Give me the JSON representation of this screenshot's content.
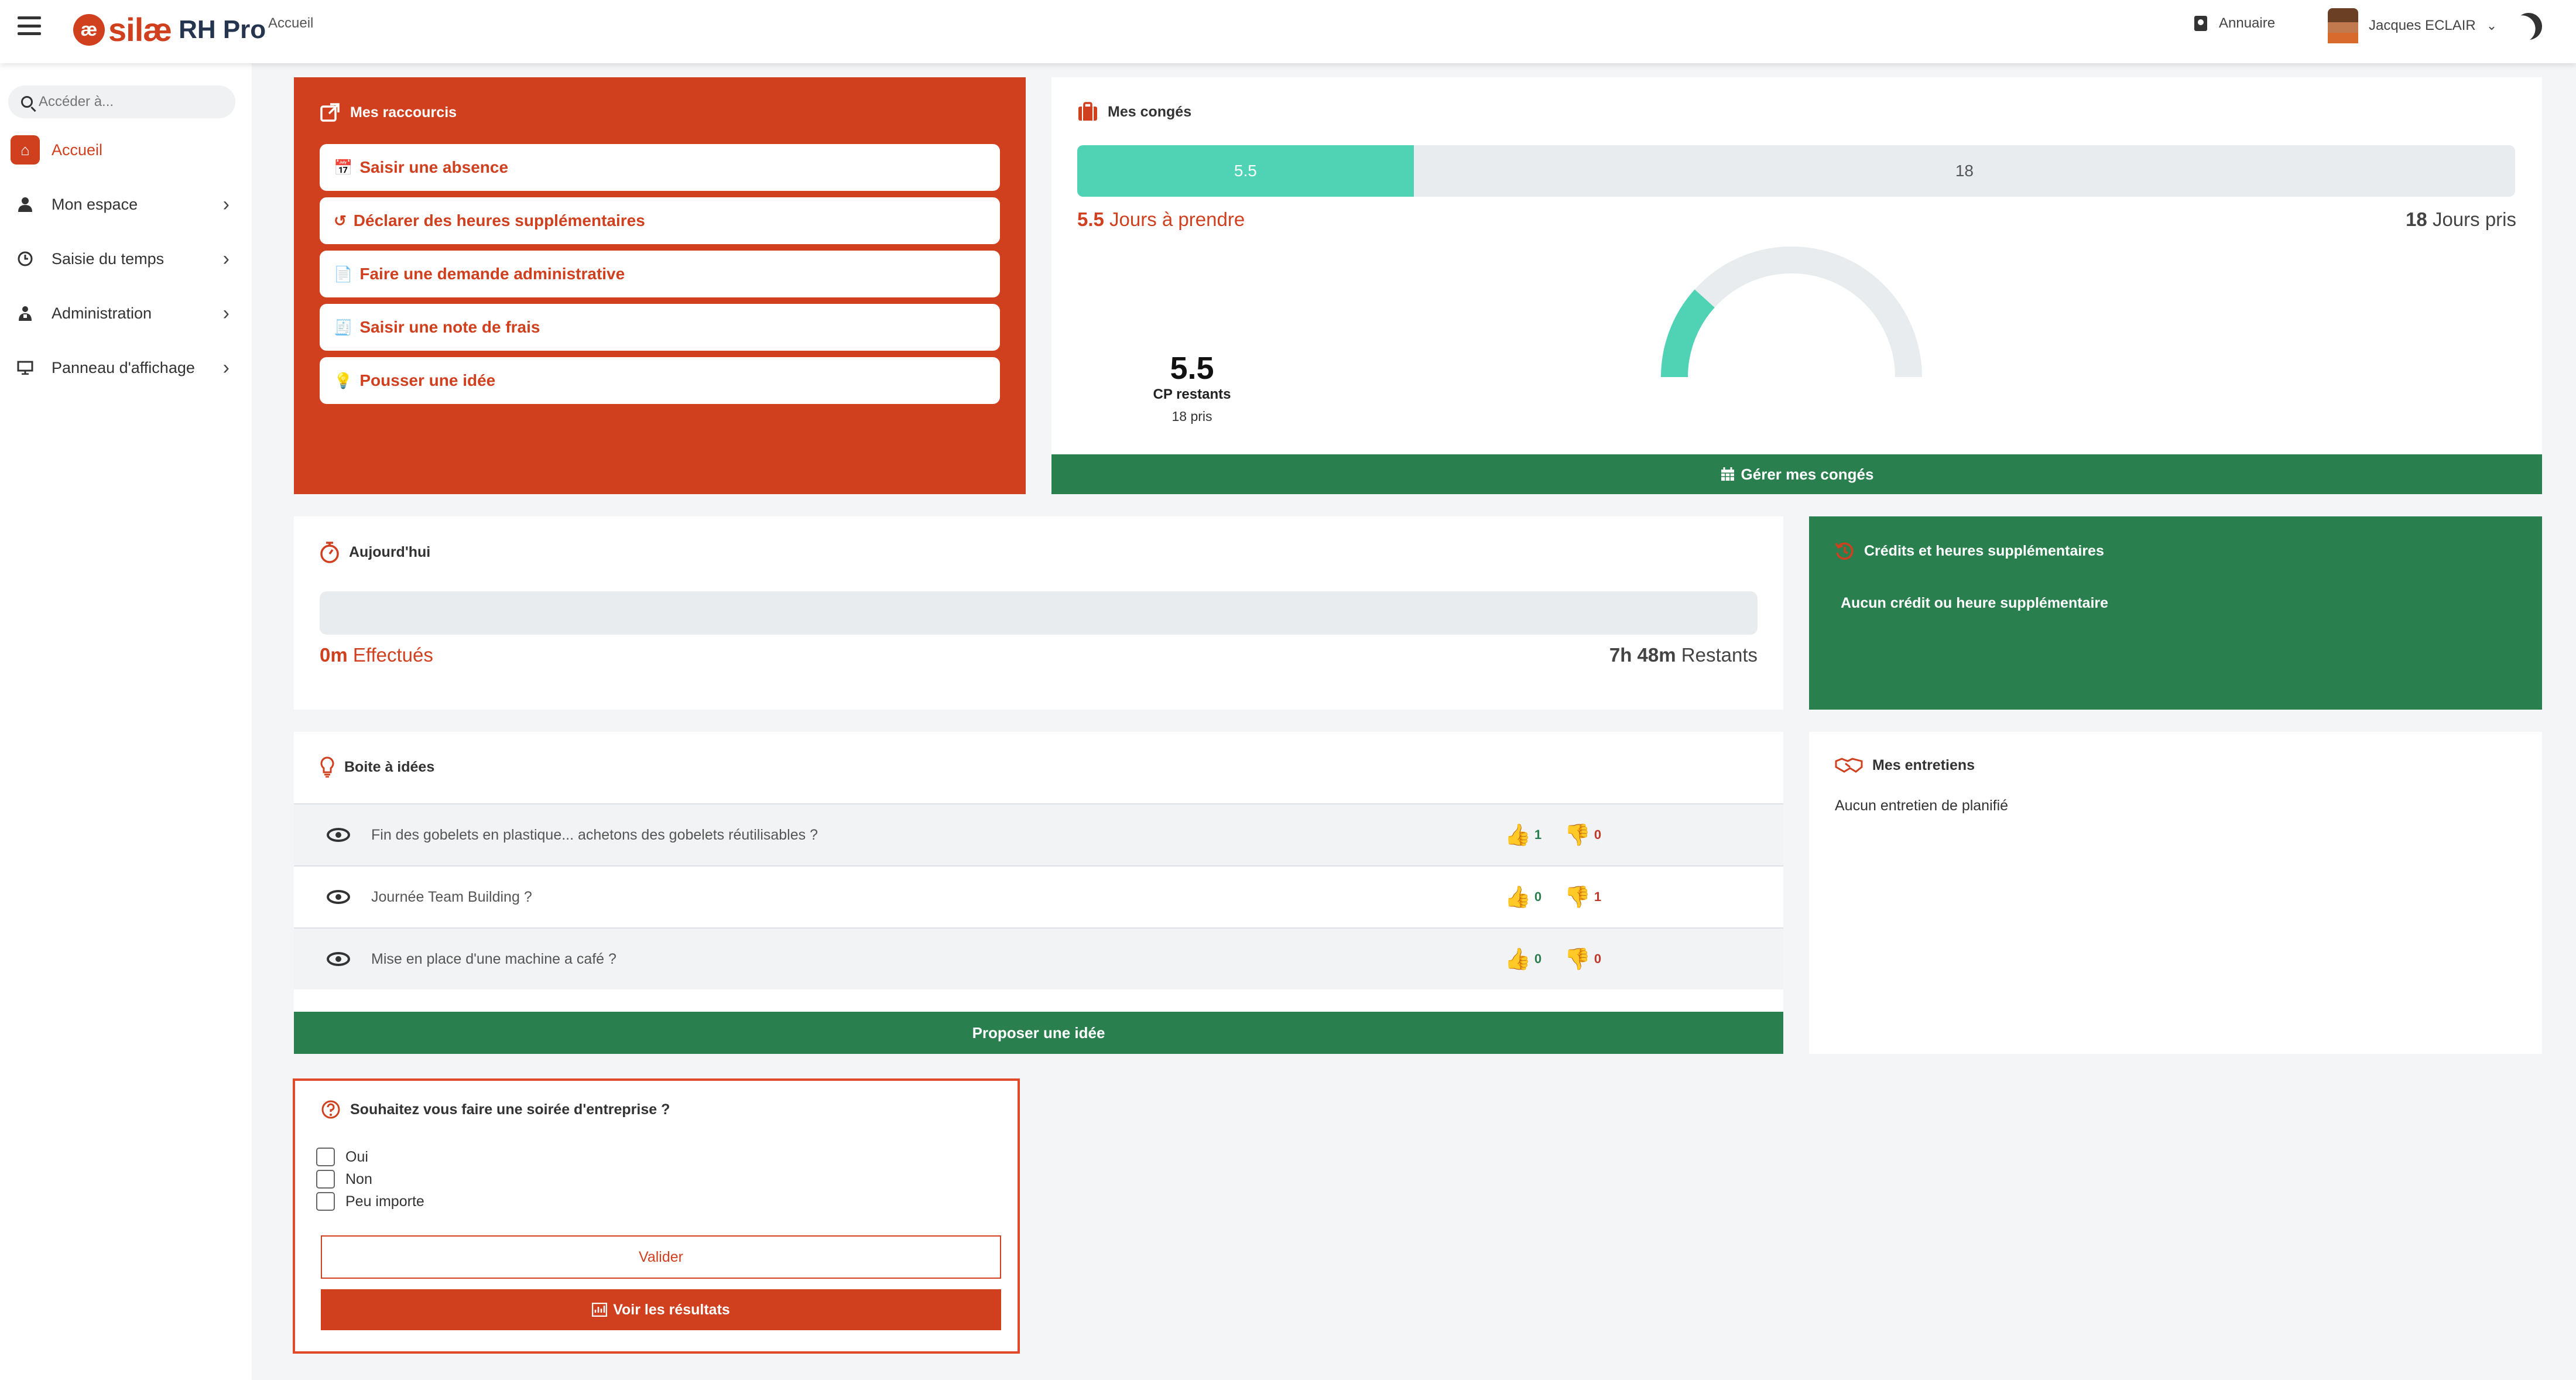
{
  "header": {
    "brand": "silæ",
    "brand_mark": "æ",
    "brand_suffix": "RH Pro",
    "breadcrumb": "Accueil",
    "annuaire": "Annuaire",
    "user_name": "Jacques ECLAIR",
    "user_chevron": "⌄"
  },
  "sidebar": {
    "search_placeholder": "Accéder à...",
    "items": [
      {
        "label": "Accueil",
        "icon": "home-icon",
        "glyph": "⌂",
        "active": true
      },
      {
        "label": "Mon espace",
        "icon": "user-icon",
        "glyph": "👤",
        "chevron": "›"
      },
      {
        "label": "Saisie du temps",
        "icon": "clock-icon",
        "glyph": "◷",
        "chevron": "›"
      },
      {
        "label": "Administration",
        "icon": "admin-icon",
        "glyph": "⚙",
        "chevron": "›"
      },
      {
        "label": "Panneau d'affichage",
        "icon": "display-icon",
        "glyph": "▭",
        "chevron": "›"
      }
    ]
  },
  "shortcuts": {
    "title": "Mes raccourcis",
    "items": [
      {
        "label": "Saisir une absence",
        "glyph": "📅"
      },
      {
        "label": "Déclarer des heures supplémentaires",
        "glyph": "↺"
      },
      {
        "label": "Faire une demande administrative",
        "glyph": "📄"
      },
      {
        "label": "Saisir une note de frais",
        "glyph": "🧾"
      },
      {
        "label": "Pousser une idée",
        "glyph": "💡"
      }
    ]
  },
  "conges": {
    "title": "Mes congés",
    "remaining": 5.5,
    "taken": 18,
    "remaining_label": "5.5",
    "taken_label": "18",
    "remaining_bold": "5.5",
    "remaining_text": " Jours à prendre",
    "taken_bold": "18",
    "taken_text": " Jours pris",
    "gauge_value": "5.5",
    "gauge_label": "CP restants",
    "gauge_sub": "18 pris",
    "manage_button": "Gérer mes congés",
    "colors": {
      "accent": "#4fd3b4",
      "track": "#e9ecef"
    }
  },
  "today": {
    "title": "Aujourd'hui",
    "done_bold": "0m",
    "done_text": " Effectués",
    "remaining_bold": "7h 48m",
    "remaining_text": " Restants"
  },
  "credits": {
    "title": "Crédits et heures supplémentaires",
    "message": "Aucun crédit ou heure supplémentaire"
  },
  "ideas": {
    "title": "Boite à idées",
    "rows": [
      {
        "text": "Fin des gobelets en plastique... achetons des gobelets réutilisables ?",
        "up": "1",
        "down": "0"
      },
      {
        "text": "Journée Team Building ?",
        "up": "0",
        "down": "1"
      },
      {
        "text": "Mise en place d'une machine a café ?",
        "up": "0",
        "down": "0"
      }
    ],
    "propose_button": "Proposer une idée"
  },
  "interviews": {
    "title": "Mes entretiens",
    "message": "Aucun entretien de planifié"
  },
  "poll": {
    "question": "Souhaitez vous faire une soirée d'entreprise ?",
    "options": [
      "Oui",
      "Non",
      "Peu importe"
    ],
    "validate_button": "Valider",
    "results_button": "Voir les résultats"
  },
  "colors": {
    "brand": "#d0401f",
    "green": "#2a7f4f",
    "background": "#f4f5f7"
  }
}
